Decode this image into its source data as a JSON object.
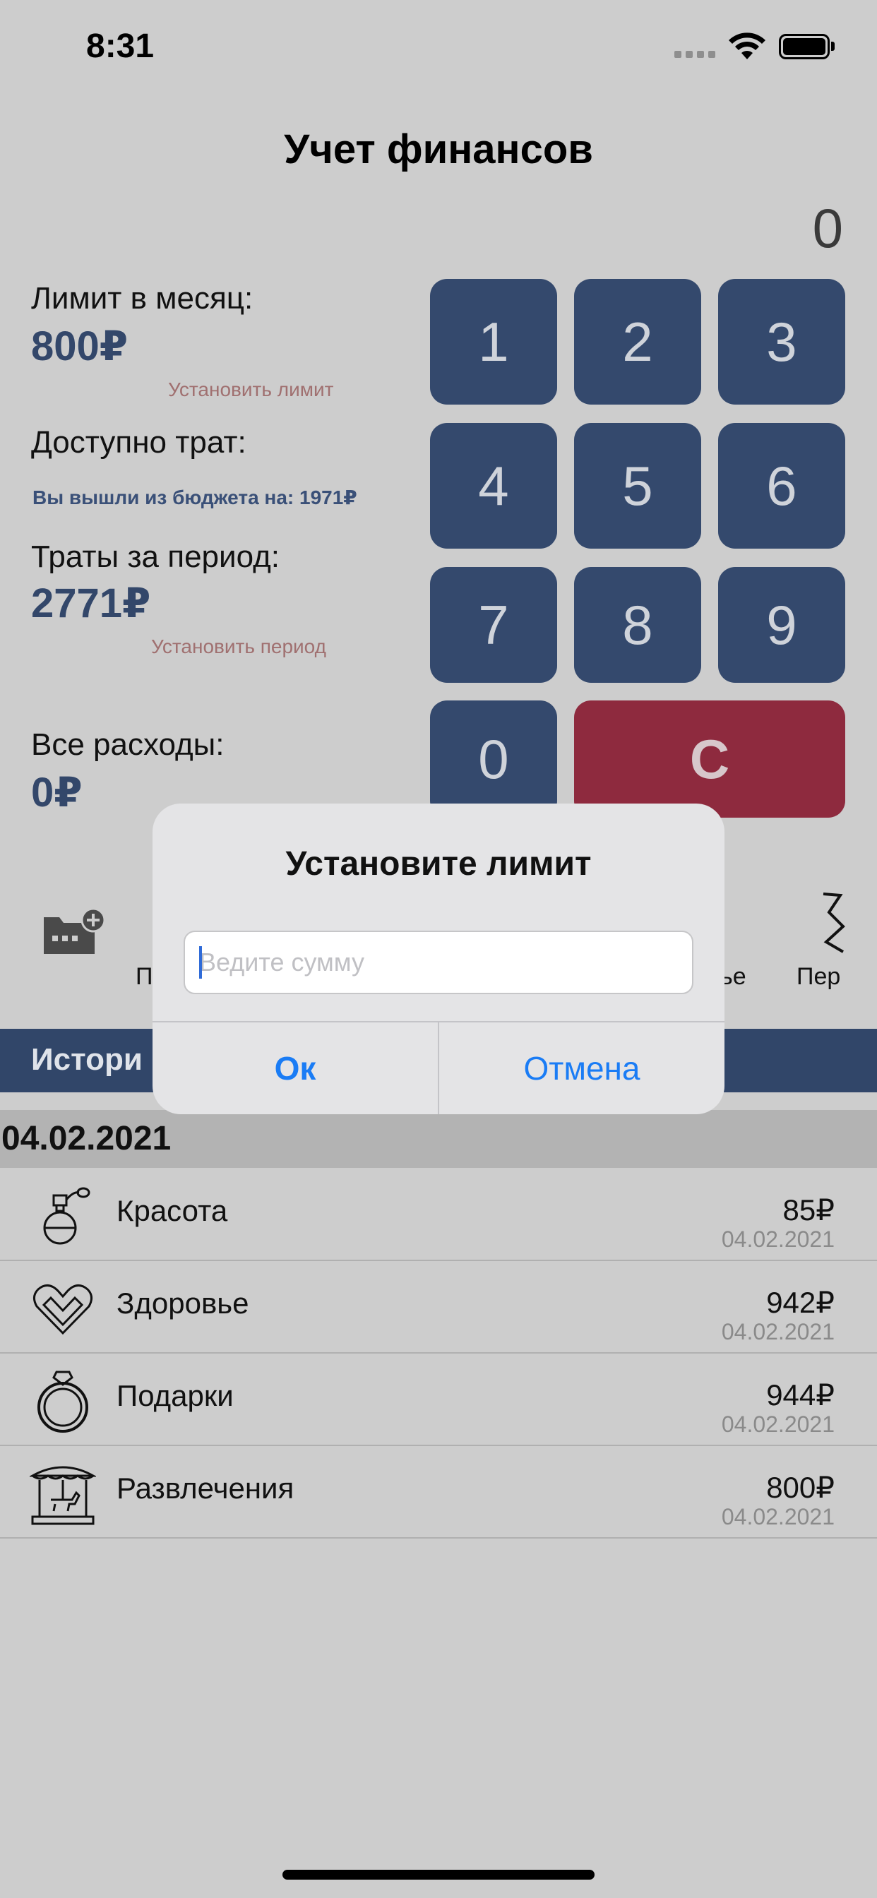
{
  "status_bar": {
    "time": "8:31"
  },
  "header": {
    "title": "Учет финансов"
  },
  "display": {
    "value": "0"
  },
  "summary": {
    "limit_label": "Лимит в месяц:",
    "limit_value": "800₽",
    "set_limit_link": "Установить лимит",
    "available_label": "Доступно трат:",
    "budget_warning": "Вы вышли из бюджета на: 1971₽",
    "period_label": "Траты за период:",
    "period_value": "2771₽",
    "set_period_link": "Установить период",
    "all_label": "Все расходы:",
    "all_value": "0₽"
  },
  "keypad": {
    "keys": [
      "1",
      "2",
      "3",
      "4",
      "5",
      "6",
      "7",
      "8",
      "9",
      "0"
    ],
    "clear": "C"
  },
  "categories": {
    "left_partial": "П",
    "right_partial_1": "ье",
    "right_partial_2": "Пер"
  },
  "history": {
    "label": "Истори"
  },
  "date_group": {
    "date": "04.02.2021"
  },
  "expenses": [
    {
      "name": "Красота",
      "amount": "85₽",
      "date": "04.02.2021",
      "icon": "perfume-icon"
    },
    {
      "name": "Здоровье",
      "amount": "942₽",
      "date": "04.02.2021",
      "icon": "heart-icon"
    },
    {
      "name": "Подарки",
      "amount": "944₽",
      "date": "04.02.2021",
      "icon": "ring-icon"
    },
    {
      "name": "Развлечения",
      "amount": "800₽",
      "date": "04.02.2021",
      "icon": "carousel-icon"
    }
  ],
  "alert": {
    "title": "Установите лимит",
    "input_placeholder": "Ведите сумму",
    "input_value": "",
    "ok_label": "Ок",
    "cancel_label": "Отмена"
  },
  "colors": {
    "key": "#34496d",
    "clear_key": "#8e2a3e",
    "history_bar": "#314669",
    "accent_blue": "#1a7cf5"
  }
}
